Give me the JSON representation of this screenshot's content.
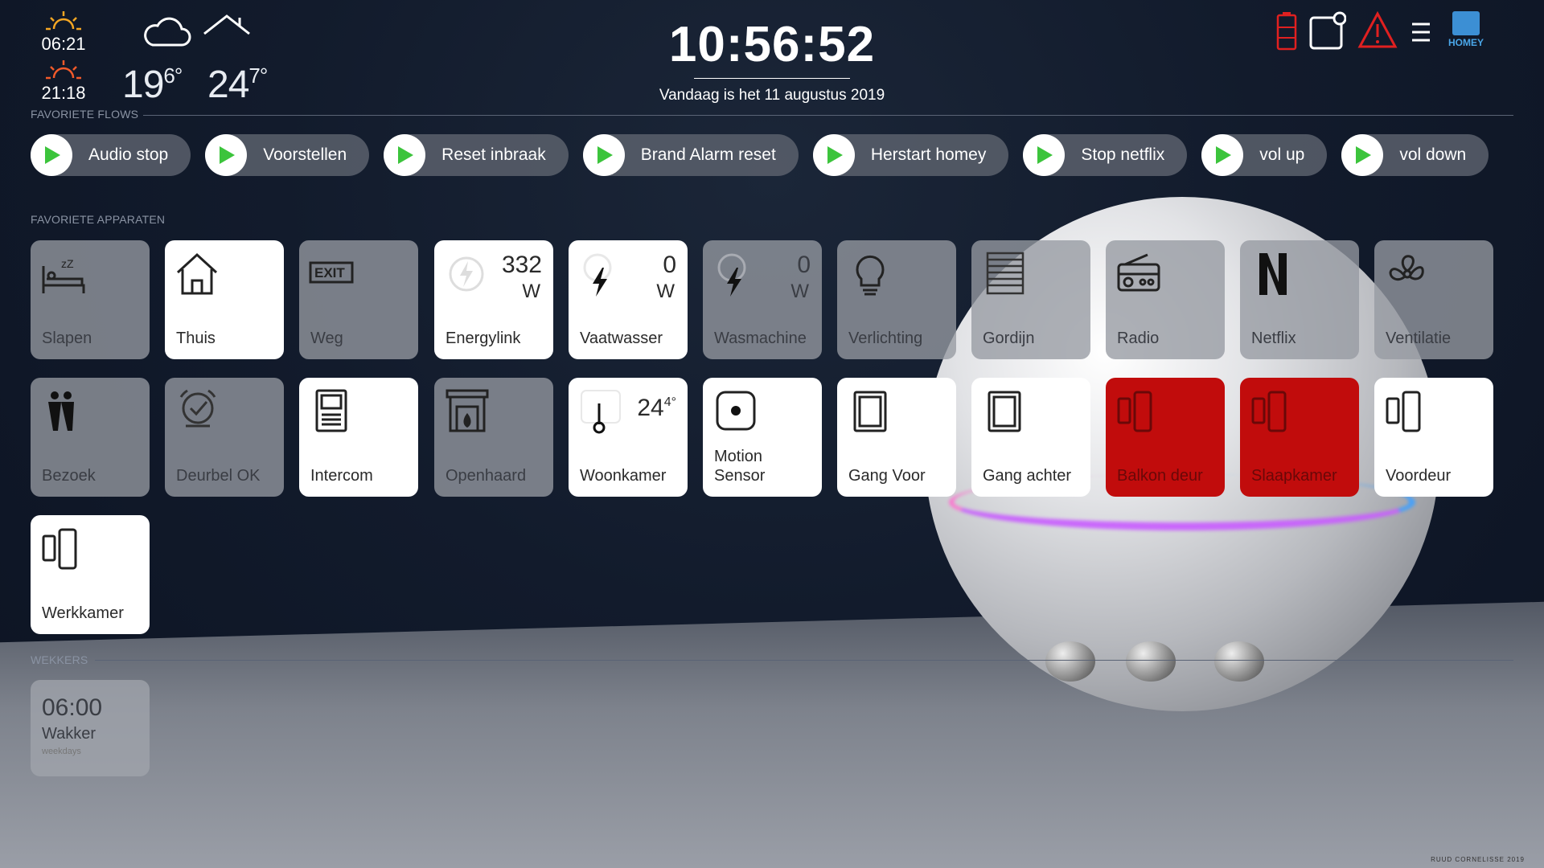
{
  "header": {
    "sunrise": "06:21",
    "sunset": "21:18",
    "weather_icon": "cloud-icon",
    "temp_outside": "19",
    "temp_outside_decimal": "6°",
    "temp_inside": "24",
    "temp_inside_decimal": "7°",
    "clock": "10:56:52",
    "date": "Vandaag is het 11 augustus 2019",
    "homey_label": "HOMEY"
  },
  "sections": {
    "flows": "FAVORIETE FLOWS",
    "devices": "FAVORIETE APPARATEN",
    "alarms": "WEKKERS"
  },
  "flows": [
    "Audio stop",
    "Voorstellen",
    "Reset inbraak",
    "Brand Alarm reset",
    "Herstart homey",
    "Stop netflix",
    "vol up",
    "vol down"
  ],
  "devices": {
    "slapen": {
      "label": "Slapen"
    },
    "thuis": {
      "label": "Thuis"
    },
    "weg": {
      "label": "Weg"
    },
    "energylink": {
      "label": "Energylink",
      "value": "332",
      "unit": "W"
    },
    "vaatwasser": {
      "label": "Vaatwasser",
      "value": "0",
      "unit": "W"
    },
    "wasmachine": {
      "label": "Wasmachine",
      "value": "0",
      "unit": "W"
    },
    "verlichting": {
      "label": "Verlichting"
    },
    "gordijn": {
      "label": "Gordijn"
    },
    "radio": {
      "label": "Radio"
    },
    "netflix": {
      "label": "Netflix"
    },
    "ventilatie": {
      "label": "Ventilatie"
    },
    "bezoek": {
      "label": "Bezoek"
    },
    "deurbel": {
      "label": "Deurbel OK"
    },
    "intercom": {
      "label": "Intercom"
    },
    "openhaard": {
      "label": "Openhaard"
    },
    "woonkamer": {
      "label": "Woonkamer",
      "value": "24",
      "decimal": "4°"
    },
    "motion": {
      "label": "Motion Sensor"
    },
    "gang_voor": {
      "label": "Gang Voor"
    },
    "gang_achter": {
      "label": "Gang achter"
    },
    "balkon": {
      "label": "Balkon deur"
    },
    "slaapkamer": {
      "label": "Slaapkamer"
    },
    "voordeur": {
      "label": "Voordeur"
    },
    "werkkamer": {
      "label": "Werkkamer"
    }
  },
  "alarm": {
    "time": "06:00",
    "name": "Wakker",
    "days": "weekdays"
  },
  "credit": "RUUD CORNELISSE 2019",
  "colors": {
    "alarm_red": "#c10c0c",
    "play_green": "#3cc43c",
    "warning_red": "#e02020"
  }
}
